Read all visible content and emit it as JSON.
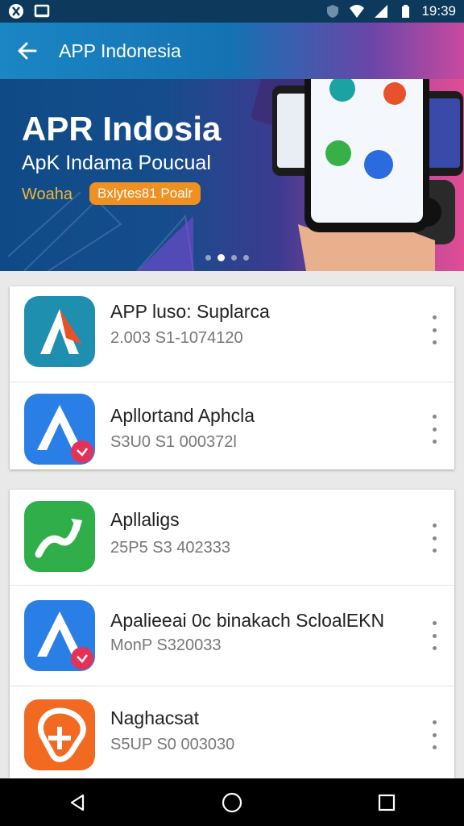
{
  "status_bar": {
    "time": "19:39",
    "icons": [
      "app-badge-icon",
      "screen-icon",
      "shield-icon",
      "wifi-icon",
      "battery-icon"
    ]
  },
  "app_bar": {
    "title": "APP Indonesia"
  },
  "hero": {
    "title": "APR Indosia",
    "subtitle": "ApK Indama Poucual",
    "tag": "Woaha",
    "pill": "Bxlytes81 Poalr",
    "dots": 4,
    "active_dot": 1
  },
  "groups": [
    {
      "apps": [
        {
          "name": "APP luso: Suplarca",
          "meta": "2.003   S1-1074120",
          "icon": "a-logo-teal-icon"
        },
        {
          "name": "Apllortand Aphcla",
          "meta": "S3U0   S1 000372l",
          "icon": "a-logo-blue-badge-icon"
        }
      ]
    },
    {
      "apps": [
        {
          "name": "Apllaligs",
          "meta": "25P5   S3 402333",
          "icon": "green-arrow-icon"
        },
        {
          "name": "Apalieeai 0c binakach ScloalEKN",
          "meta": "MonP   S320033",
          "icon": "a-logo-blue-badge-icon"
        },
        {
          "name": "Naghacsat",
          "meta": "S5UP   S0 003030",
          "icon": "orange-logo-icon"
        }
      ]
    }
  ],
  "nav": {
    "buttons": [
      "back-triangle-icon",
      "home-circle-icon",
      "recents-square-icon"
    ]
  },
  "colors": {
    "status_bar": "#0d3a5c",
    "accent": "#1572b2",
    "pill": "#f09020"
  }
}
